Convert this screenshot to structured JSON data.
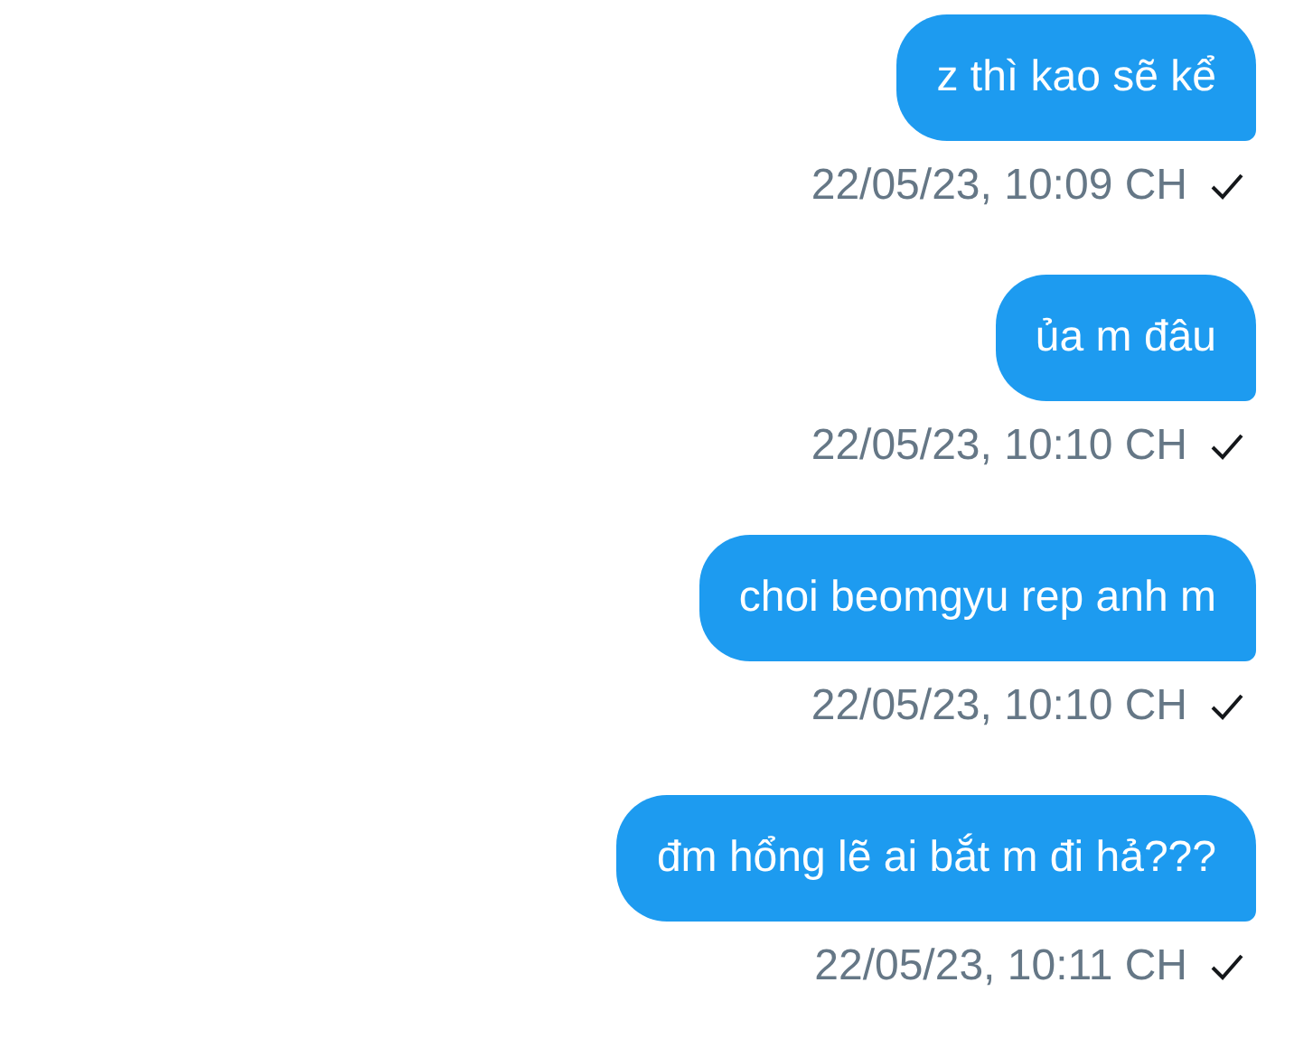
{
  "messages": [
    {
      "text": "z thì kao sẽ kể",
      "time": "22/05/23, 10:09 CH"
    },
    {
      "text": "ủa m đâu",
      "time": "22/05/23, 10:10 CH"
    },
    {
      "text": "choi beomgyu rep anh m",
      "time": "22/05/23, 10:10 CH"
    },
    {
      "text": "đm hổng lẽ ai bắt m đi hả???",
      "time": "22/05/23, 10:11 CH"
    }
  ]
}
